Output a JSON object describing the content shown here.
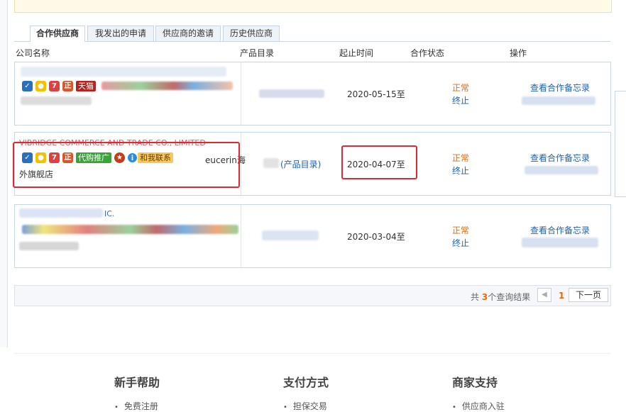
{
  "tabs": [
    {
      "label": "合作供应商",
      "active": true
    },
    {
      "label": "我发出的申请",
      "active": false
    },
    {
      "label": "供应商的邀请",
      "active": false
    },
    {
      "label": "历史供应商",
      "active": false
    }
  ],
  "columns": {
    "company": "公司名称",
    "catalog": "产品目录",
    "period": "起止时间",
    "status": "合作状态",
    "action": "操作"
  },
  "rows": [
    {
      "badge_tmall": "天猫",
      "date": "2020-05-15至",
      "status_normal": "正常",
      "status_end": "终止",
      "action": "查看合作备忘录"
    },
    {
      "company_name": "VIBRIDGE COMMERCE AND TRADE CO., LIMITED",
      "tag_promo": "代购推广",
      "tag_contact": "和我联系",
      "shop_line1": "eucerin海",
      "shop_line2": "外旗舰店",
      "catalog_link": "(产品目录)",
      "date": "2020-04-07至",
      "status_normal": "正常",
      "status_end": "终止",
      "action": "查看合作备忘录"
    },
    {
      "company_suffix": "IC.",
      "date": "2020-03-04至",
      "status_normal": "正常",
      "status_end": "终止",
      "action": "查看合作备忘录"
    }
  ],
  "pager": {
    "prefix": "共",
    "count": "3",
    "suffix": "个查询结果",
    "current": "1",
    "next": "下一页"
  },
  "footer": [
    {
      "title": "新手帮助",
      "item": "免费注册"
    },
    {
      "title": "支付方式",
      "item": "担保交易"
    },
    {
      "title": "商家支持",
      "item": "供应商入驻"
    }
  ],
  "colors": {
    "accent_orange": "#e8690a",
    "link_blue": "#1b62b5",
    "highlight_red": "#e0282e"
  }
}
